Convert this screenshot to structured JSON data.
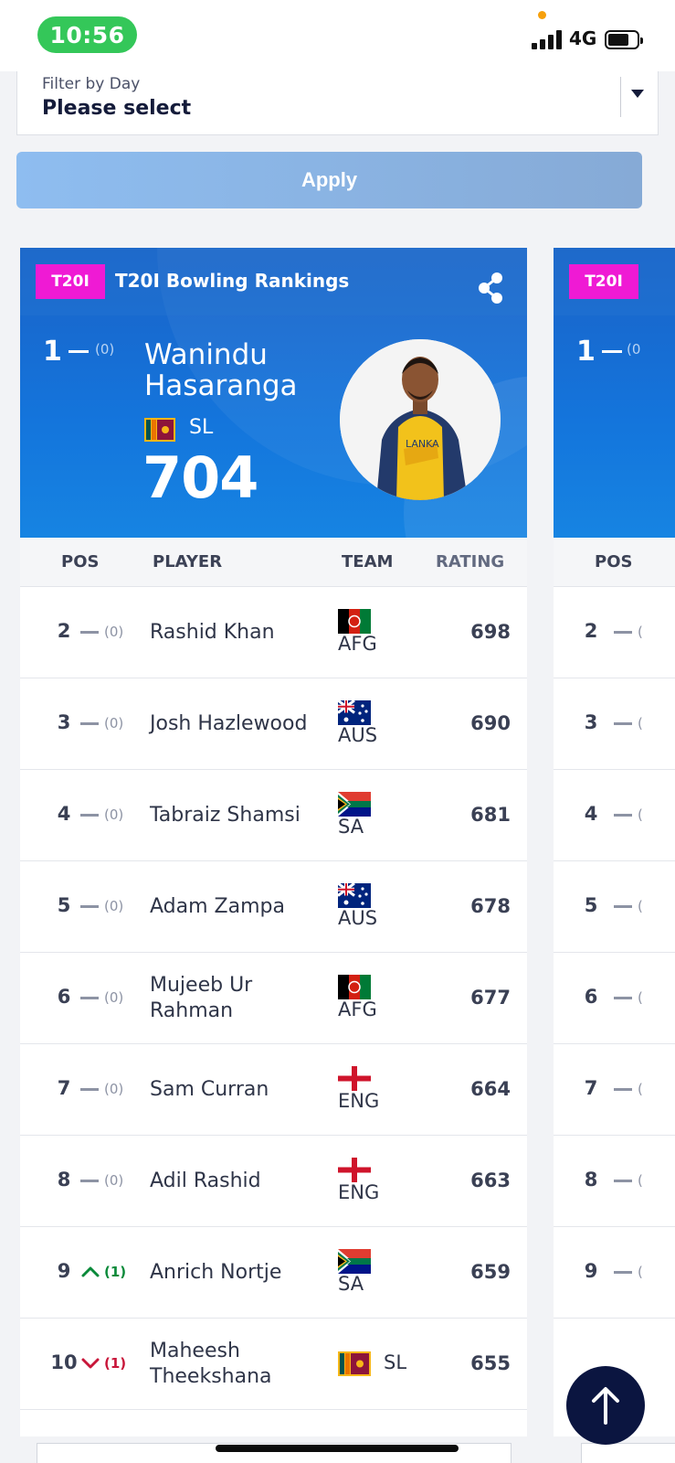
{
  "status_bar": {
    "time": "10:56",
    "network": "4G"
  },
  "filter": {
    "label": "Filter by Day",
    "value": "Please select"
  },
  "apply_label": "Apply",
  "card": {
    "format_badge": "T20I",
    "title": "T20I Bowling Rankings",
    "leader": {
      "position": "1",
      "change": "(0)",
      "first_name": "Wanindu",
      "last_name": "Hasaranga",
      "team": "SL",
      "rating": "704"
    },
    "columns": {
      "pos": "POS",
      "player": "PLAYER",
      "team": "TEAM",
      "rating": "RATING"
    },
    "rows": [
      {
        "pos": "2",
        "move": "none",
        "change": "(0)",
        "name": "Rashid Khan",
        "team": "AFG",
        "flag": "afg-flag",
        "rating": "698"
      },
      {
        "pos": "3",
        "move": "none",
        "change": "(0)",
        "name": "Josh Hazlewood",
        "team": "AUS",
        "flag": "aus-flag",
        "rating": "690"
      },
      {
        "pos": "4",
        "move": "none",
        "change": "(0)",
        "name": "Tabraiz Shamsi",
        "team": "SA",
        "flag": "sa-flag",
        "rating": "681"
      },
      {
        "pos": "5",
        "move": "none",
        "change": "(0)",
        "name": "Adam Zampa",
        "team": "AUS",
        "flag": "aus-flag",
        "rating": "678"
      },
      {
        "pos": "6",
        "move": "none",
        "change": "(0)",
        "name": "Mujeeb Ur Rahman",
        "team": "AFG",
        "flag": "afg-flag",
        "rating": "677"
      },
      {
        "pos": "7",
        "move": "none",
        "change": "(0)",
        "name": "Sam Curran",
        "team": "ENG",
        "flag": "eng-flag",
        "rating": "664"
      },
      {
        "pos": "8",
        "move": "none",
        "change": "(0)",
        "name": "Adil Rashid",
        "team": "ENG",
        "flag": "eng-flag",
        "rating": "663"
      },
      {
        "pos": "9",
        "move": "up",
        "change": "(1)",
        "name": "Anrich Nortje",
        "team": "SA",
        "flag": "sa-flag",
        "rating": "659"
      },
      {
        "pos": "10",
        "move": "down",
        "change": "(1)",
        "name": "Maheesh Theekshana",
        "team": "SL",
        "flag": "sl-flag",
        "rating": "655"
      }
    ]
  },
  "next_card": {
    "format_badge": "T20I",
    "leader_position": "1",
    "leader_change": "(0",
    "pos_header": "POS",
    "positions": [
      "2",
      "3",
      "4",
      "5",
      "6",
      "7",
      "8",
      "9"
    ],
    "change_partial": "("
  },
  "colors": {
    "badge": "#ef1ad4",
    "header_blue": "#1475dc",
    "up": "#0a8a3a",
    "down": "#c8163a",
    "scroll_button": "#0b1540"
  }
}
